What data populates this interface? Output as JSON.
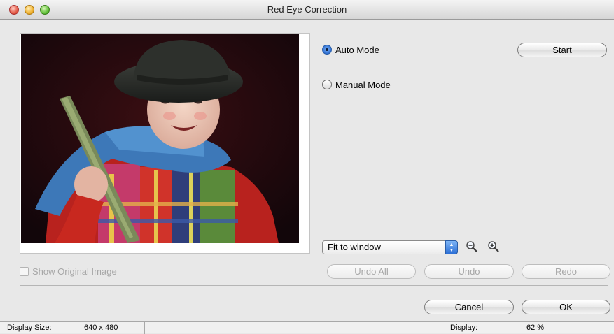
{
  "window": {
    "title": "Red Eye Correction"
  },
  "mode": {
    "auto_label": "Auto Mode",
    "manual_label": "Manual Mode",
    "selected": "auto"
  },
  "buttons": {
    "start": "Start",
    "undo_all": "Undo All",
    "undo": "Undo",
    "redo": "Redo",
    "cancel": "Cancel",
    "ok": "OK"
  },
  "zoom": {
    "selected_option": "Fit to window",
    "zoom_out_icon": "zoom-out-icon",
    "zoom_in_icon": "zoom-in-icon"
  },
  "show_original": {
    "label": "Show Original Image",
    "checked": false,
    "enabled": false
  },
  "status": {
    "display_size_label": "Display Size:",
    "display_size_value": "640 x 480",
    "display_label": "Display:",
    "display_value": "62 %"
  },
  "colors": {
    "accent": "#2f6fd3",
    "disabled_text": "#a7a7a7",
    "window_bg": "#e8e8e8"
  }
}
